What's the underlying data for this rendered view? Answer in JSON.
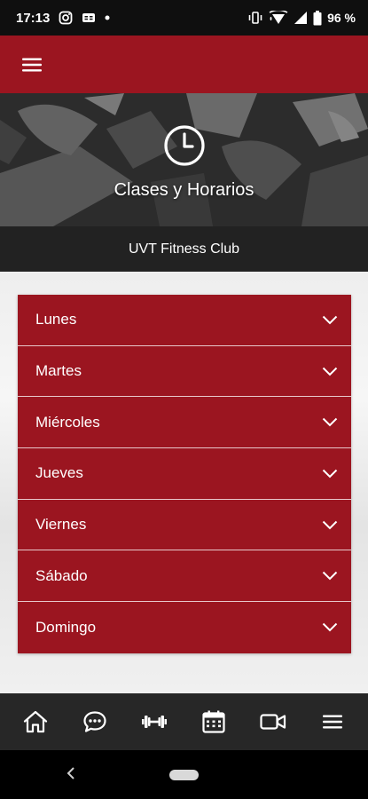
{
  "status_bar": {
    "time": "17:13",
    "battery": "96 %",
    "icons": [
      "instagram-icon",
      "caption-icon",
      "dot-icon",
      "vibrate-icon",
      "wifi-icon",
      "signal-icon",
      "battery-icon"
    ]
  },
  "app_bar": {
    "menu_icon": "hamburger-menu-icon"
  },
  "hero": {
    "icon": "clock-icon",
    "title": "Clases y Horarios"
  },
  "sub_bar": {
    "title": "UVT Fitness Club"
  },
  "days": [
    {
      "label": "Lunes"
    },
    {
      "label": "Martes"
    },
    {
      "label": "Miércoles"
    },
    {
      "label": "Jueves"
    },
    {
      "label": "Viernes"
    },
    {
      "label": "Sábado"
    },
    {
      "label": "Domingo"
    }
  ],
  "bottom_nav": {
    "items": [
      "home-icon",
      "chat-icon",
      "dumbbell-icon",
      "calendar-icon",
      "video-icon",
      "menu-icon"
    ]
  },
  "colors": {
    "accent": "#9b1520",
    "dark_bar": "#222222",
    "nav_bg": "#272727"
  }
}
